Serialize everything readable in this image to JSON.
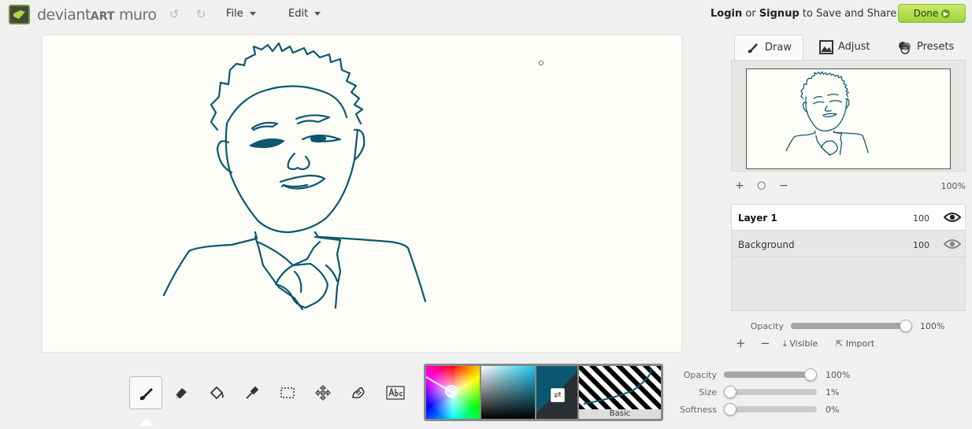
{
  "app": {
    "logo_text_1": "deviant",
    "logo_text_2": "ART",
    "logo_text_3": " muro"
  },
  "menu": {
    "file": "File",
    "edit": "Edit"
  },
  "header": {
    "login": "Login",
    "or": " or ",
    "signup": "Signup",
    "save_share": " to Save and Share!",
    "done": "Done"
  },
  "tabs": {
    "draw": "Draw",
    "adjust": "Adjust",
    "presets": "Presets"
  },
  "preview": {
    "zoom": "100%"
  },
  "layers": [
    {
      "name": "Layer 1",
      "opacity": "100"
    },
    {
      "name": "Background",
      "opacity": "100"
    }
  ],
  "layer_opacity": {
    "label": "Opacity",
    "value_text": "100%",
    "value": 1.0
  },
  "layer_actions": {
    "visible": "Visible",
    "import": "Import"
  },
  "brush_settings": {
    "opacity_label": "Opacity",
    "opacity_text": "100%",
    "opacity": 1.0,
    "size_label": "Size",
    "size_text": "1%",
    "size": 0.01,
    "softness_label": "Softness",
    "softness_text": "0%",
    "softness": 0.0
  },
  "brush": {
    "name": "Basic"
  },
  "colors": {
    "primary": "#0c5770",
    "secondary": "#2a2f33",
    "done_green": "#a6d642",
    "stroke": "#0c5770"
  },
  "tools": [
    {
      "name": "brush-icon",
      "active": true
    },
    {
      "name": "eraser-icon",
      "active": false
    },
    {
      "name": "fill-bucket-icon",
      "active": false
    },
    {
      "name": "eyedropper-icon",
      "active": false
    },
    {
      "name": "marquee-select-icon",
      "active": false
    },
    {
      "name": "move-icon",
      "active": false
    },
    {
      "name": "smudge-icon",
      "active": false
    },
    {
      "name": "text-icon",
      "active": false
    }
  ]
}
